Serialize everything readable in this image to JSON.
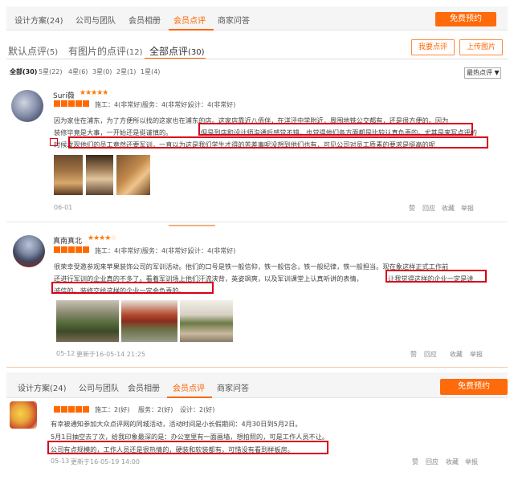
{
  "topnav": {
    "items": [
      "设计方案(24)",
      "公司与团队",
      "会员相册",
      "会员点评",
      "商家问答"
    ],
    "active_index": 3,
    "book_label": "免费预约"
  },
  "tabs": {
    "items": [
      "默认点评",
      "有图片的点评",
      "全部点评"
    ],
    "counts": [
      "(5)",
      "(12)",
      "(30)"
    ],
    "active_index": 2,
    "write_label": "我要点评",
    "upload_label": "上传图片"
  },
  "filters": {
    "items": [
      "全部(30)",
      "5星(22)",
      "4星(6)",
      "3星(0)",
      "2星(1)",
      "1星(4)"
    ],
    "sort_label": "最热点评 ▼"
  },
  "reviews": [
    {
      "username": "Suri薇",
      "stars": 5,
      "scores": [
        "施工：4(非常好)",
        "服务：4(非常好)",
        "设计：4(非常好)"
      ],
      "lines": [
        "因为家住在浦东，为了方便所以找的这家也在浦东的店。这家店靠近八佰伴，在洋泾中学附近，周围地铁公交都有，还是很方便的。因为",
        "装修毕竟是大事，一开始还是挺谨慎的。",
        "但是到店和设计师沟通后感觉不错，也觉得他们各方面都是比较认真负责的。尤其是来写点评的",
        "时候发现他们的员工竟然还要军训，一直以为这是我们学生才得的苦差事呢没想到他们也有，可见公司对员工质素的要求是挺高的呢"
      ],
      "date": "06-01",
      "actions": [
        "赞",
        "回应",
        "收藏",
        "举报"
      ]
    },
    {
      "username": "真南真北",
      "stars": 4.5,
      "scores": [
        "施工：4(非常好)",
        "服务：4(非常好)",
        "设计：4(非常好)"
      ],
      "lines": [
        "很荣幸受邀参观来苹果装饰公司的军训活动。他们的口号是铁一般信仰，铁一般信念，铁一般纪律，铁一般担当。现在象这样正式工作前",
        "还进行军训的企业真的不多了。看着军训场上他们汗流浃背，英姿飒爽，以及军训课堂上认真听讲的表情，",
        "让我觉得这样的企业一定是讲",
        "诚信的。装修交给这样的企业一定会负责的。"
      ],
      "date": "05-12",
      "updated": "更新于16-05-14 21:25",
      "actions": [
        "赞",
        "回应",
        "收藏",
        "举报"
      ]
    },
    {
      "username": "",
      "scores": [
        "施工：2(好)",
        "服务：2(好)",
        "设计：2(好)"
      ],
      "lines": [
        "有幸被通知参加大众点评网的同城活动，活动时间是小长假期间：4月30日到5月2日。",
        "5月1日抽空去了次，给我印象最深的是：办公室里有一面画墙，想拍照的，可是工作人员不让。",
        "公司有点规模的，工作人员还是很热情的，硬装和软装都有，可惜没有看到样板房。"
      ],
      "date": "05-13",
      "updated": "更新于16-05-19 14:00",
      "actions": [
        "赞",
        "回应",
        "收藏",
        "举报"
      ]
    }
  ],
  "colors": {
    "accent": "#ff6600",
    "highlight_box": "#d8001a"
  }
}
